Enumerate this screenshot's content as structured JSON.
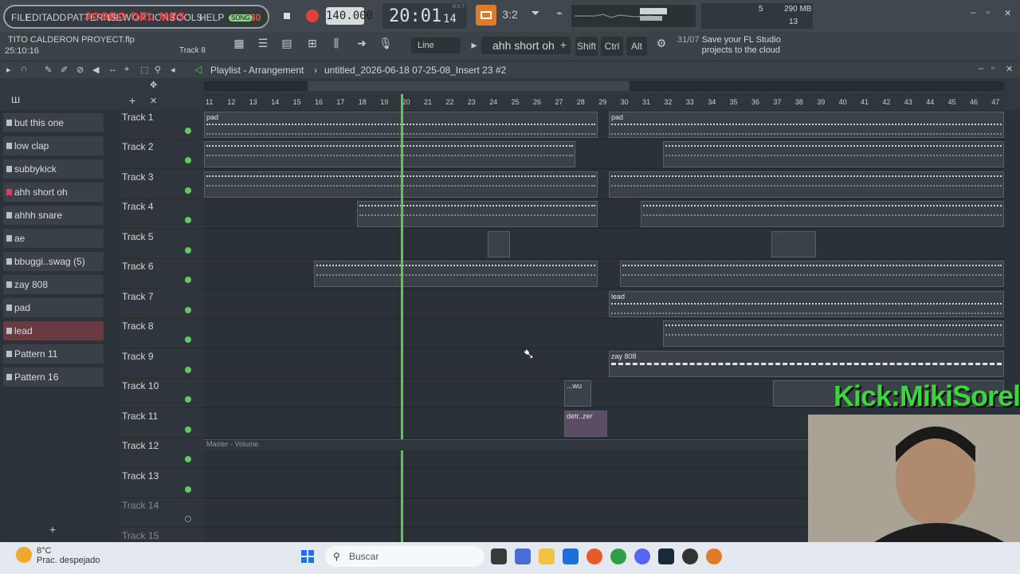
{
  "menu": {
    "items": [
      "FILE",
      "EDIT",
      "ADD",
      "PATTERNS",
      "VIEW",
      "OPTIONS",
      "TOOLS",
      "HELP"
    ],
    "overlay_text": "JOSEO DEL MES",
    "song_label": "SONG",
    "song_num": "30"
  },
  "transport": {
    "tempo": "140.000",
    "time_main": "20:01",
    "time_sub": "14",
    "bst": "B:S:T",
    "pattern_num": "3:2",
    "cpu": "5",
    "ram": "290 MB",
    "voices": "13"
  },
  "project": {
    "name": "TITO CALDERON PROYECT.flp",
    "time": "25:10:16",
    "track": "Track 8"
  },
  "toolbar": {
    "snap": "Line",
    "pattern": "ahh short oh",
    "keys": [
      "Shift",
      "Ctrl",
      "Alt"
    ],
    "hint_date": "31/07",
    "hint_text": "Save your FL Studio projects to the cloud"
  },
  "playlist": {
    "title": "Playlist - Arrangement",
    "sep": "›",
    "name": "untitled_2026-06-18 07-25-08_Insert 23 #2"
  },
  "channels": [
    {
      "label": "but this one"
    },
    {
      "label": "low clap"
    },
    {
      "label": "subbykick"
    },
    {
      "label": "ahh short oh"
    },
    {
      "label": "ahhh snare"
    },
    {
      "label": "ae"
    },
    {
      "label": "bbuggi..swag (5)"
    },
    {
      "label": "zay 808"
    },
    {
      "label": "pad"
    },
    {
      "label": "lead"
    },
    {
      "label": "Pattern 11"
    },
    {
      "label": "Pattern 16"
    }
  ],
  "tracks": [
    "Track 1",
    "Track 2",
    "Track 3",
    "Track 4",
    "Track 5",
    "Track 6",
    "Track 7",
    "Track 8",
    "Track 9",
    "Track 10",
    "Track 11",
    "Track 12",
    "Track 13",
    "Track 14",
    "Track 15"
  ],
  "ruler": [
    "11",
    "12",
    "13",
    "14",
    "15",
    "16",
    "17",
    "18",
    "19",
    "20",
    "21",
    "22",
    "23",
    "24",
    "25",
    "26",
    "27",
    "28",
    "29",
    "30",
    "31",
    "32",
    "33",
    "34",
    "35",
    "36",
    "37",
    "38",
    "39",
    "40",
    "41",
    "42",
    "43",
    "44",
    "45",
    "46",
    "47"
  ],
  "clips": {
    "pad": "pad",
    "lead": "lead",
    "zay": "zay 808",
    "wu": "...wu",
    "detr": "detr..zer"
  },
  "master_lane": "Master - Volume",
  "overlay_kick": "Kick:MikiSorel",
  "taskbar": {
    "temp": "8°C",
    "weather": "Prac. despejado",
    "search": "Buscar"
  },
  "colors": {
    "accent_green": "#4fd04d",
    "record": "#e0413a",
    "pattern_orange": "#e07b2a"
  }
}
